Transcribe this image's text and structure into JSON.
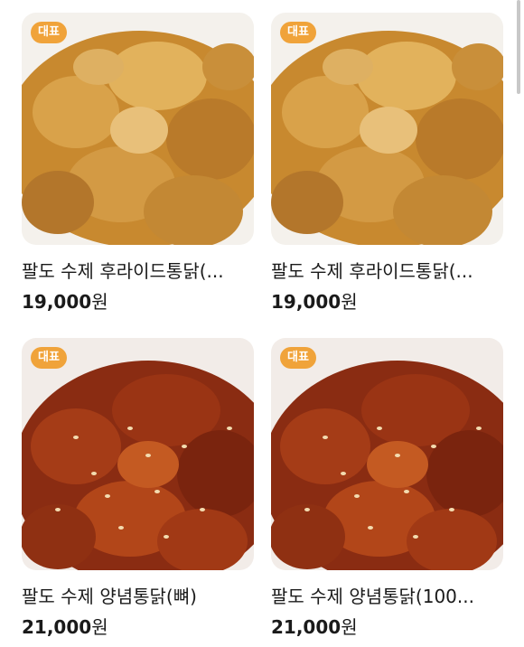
{
  "products": [
    {
      "badge": "대표",
      "name": "팔도 수제 후라이드통닭(...",
      "price_value": "19,000",
      "price_unit": "원",
      "image": "fried-chicken"
    },
    {
      "badge": "대표",
      "name": "팔도 수제 후라이드통닭(...",
      "price_value": "19,000",
      "price_unit": "원",
      "image": "fried-chicken"
    },
    {
      "badge": "대표",
      "name": "팔도 수제 양념통닭(뼈)",
      "price_value": "21,000",
      "price_unit": "원",
      "image": "seasoned-chicken"
    },
    {
      "badge": "대표",
      "name": "팔도 수제 양념통닭(100...",
      "price_value": "21,000",
      "price_unit": "원",
      "image": "seasoned-chicken"
    }
  ],
  "colors": {
    "badge_bg": "#f0a33a",
    "fried": "#c8892f",
    "seasoned": "#8a2c12"
  }
}
